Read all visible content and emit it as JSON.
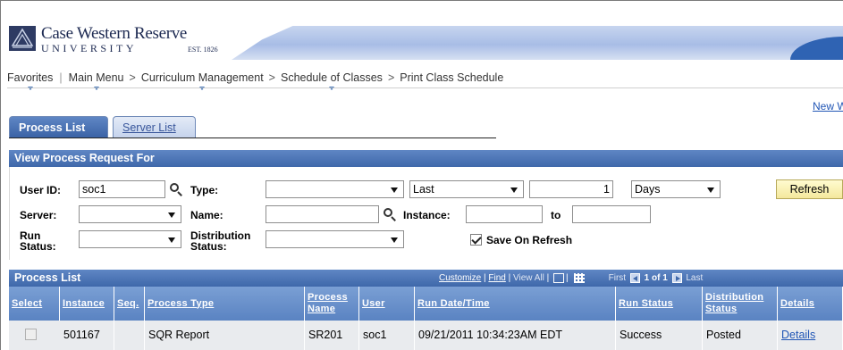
{
  "header": {
    "university_name": "Case Western Reserve",
    "university_sub": "UNIVERSITY",
    "est": "EST. 1826"
  },
  "breadcrumb": {
    "items": [
      "Favorites",
      "Main Menu",
      "Curriculum Management",
      "Schedule of Classes",
      "Print Class Schedule"
    ],
    "separator": ">"
  },
  "new_window_link": "New W",
  "tabs": [
    {
      "label": "Process List",
      "active": true
    },
    {
      "label": "Server List",
      "active": false
    }
  ],
  "view_request": {
    "title": "View Process Request For",
    "user_id_label": "User ID:",
    "user_id_value": "soc1",
    "type_label": "Type:",
    "type_value": "",
    "last_value": "Last",
    "last_number": "1",
    "days_value": "Days",
    "refresh_label": "Refresh",
    "server_label": "Server:",
    "server_value": "",
    "name_label": "Name:",
    "name_value": "",
    "instance_label": "Instance:",
    "instance_from": "",
    "to_label": "to",
    "instance_to": "",
    "run_status_label": "Run Status:",
    "run_status_value": "",
    "distribution_label": "Distribution Status:",
    "distribution_value": "",
    "save_on_refresh_label": "Save On Refresh",
    "save_on_refresh_checked": true
  },
  "process_list": {
    "title": "Process List",
    "tools": {
      "customize": "Customize",
      "find": "Find",
      "view_all": "View All",
      "first": "First",
      "range": "1 of 1",
      "last": "Last"
    },
    "columns": [
      "Select",
      "Instance",
      "Seq.",
      "Process Type",
      "Process Name",
      "User",
      "Run Date/Time",
      "Run Status",
      "Distribution Status",
      "Details"
    ],
    "rows": [
      {
        "select": false,
        "instance": "501167",
        "seq": "",
        "process_type": "SQR Report",
        "process_name": "SR201",
        "user": "soc1",
        "run_datetime": "09/21/2011 10:34:23AM EDT",
        "run_status": "Success",
        "distribution_status": "Posted",
        "details": "Details"
      }
    ]
  },
  "colors": {
    "header_blue": "#3f68aa",
    "link": "#2055b5",
    "button_yellow": "#f4e89c"
  }
}
